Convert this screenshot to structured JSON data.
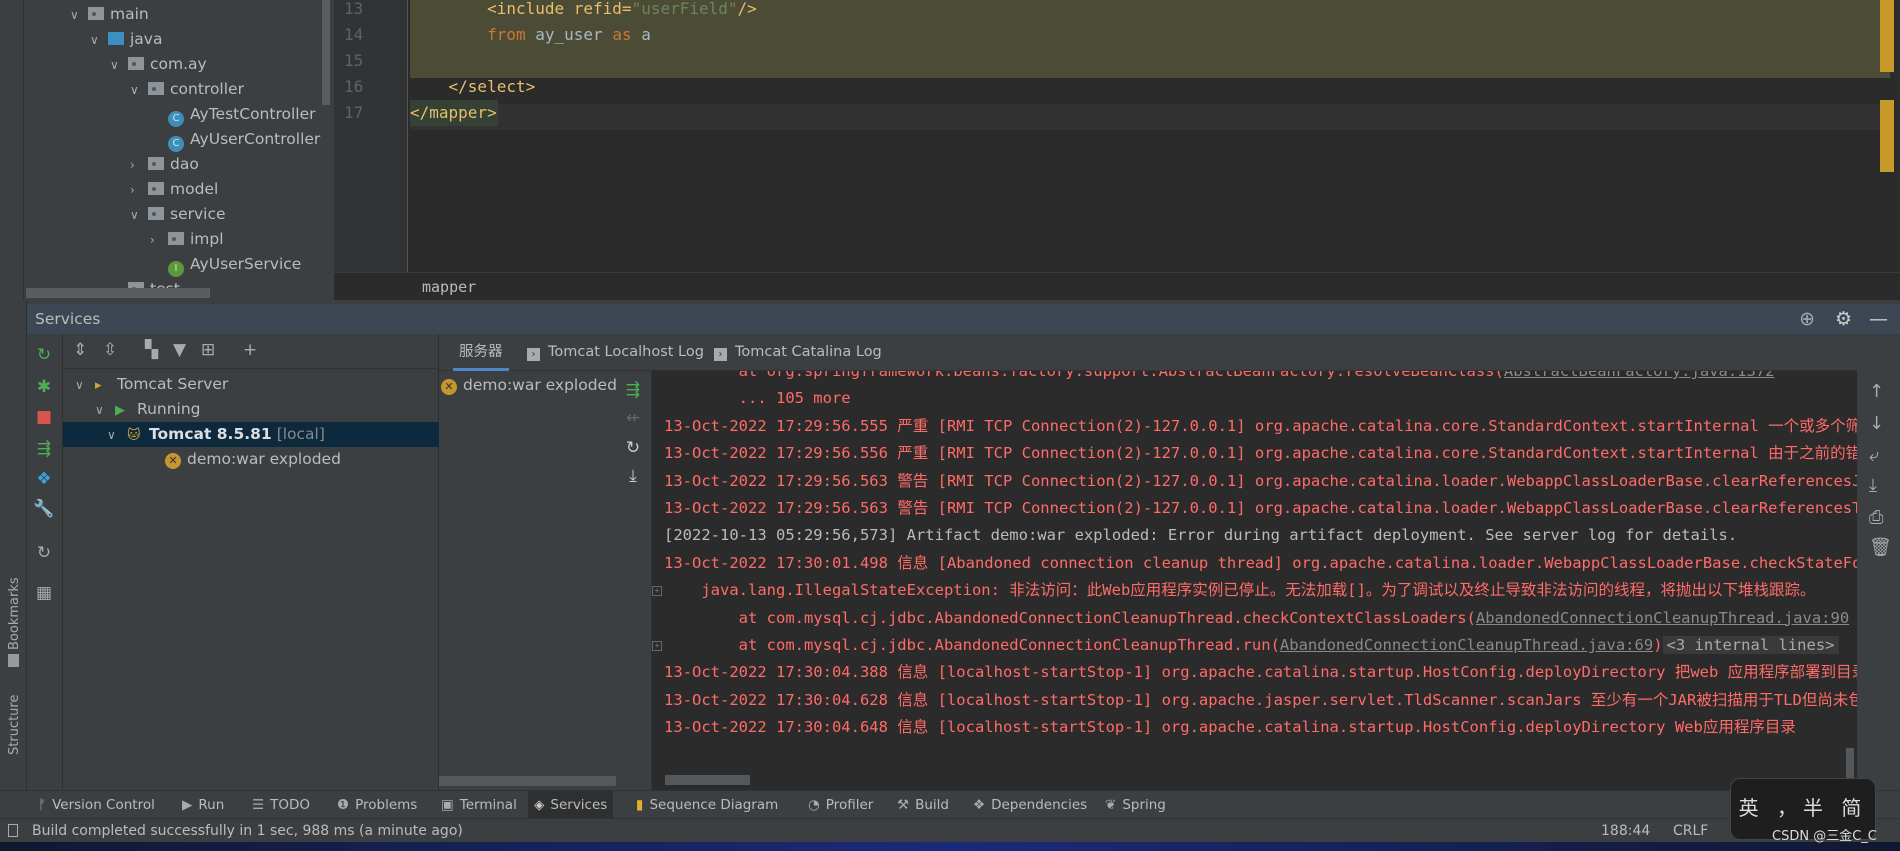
{
  "project_tree": {
    "items": [
      {
        "label": "main",
        "arrow": "expanded",
        "icon": "folder",
        "level": 0
      },
      {
        "label": "java",
        "arrow": "expanded",
        "icon": "source-folder",
        "level": 1
      },
      {
        "label": "com.ay",
        "arrow": "expanded",
        "icon": "package",
        "level": 2
      },
      {
        "label": "controller",
        "arrow": "expanded",
        "icon": "package",
        "level": 3
      },
      {
        "label": "AyTestController",
        "arrow": "",
        "icon": "class",
        "level": 4
      },
      {
        "label": "AyUserController",
        "arrow": "",
        "icon": "class",
        "level": 4
      },
      {
        "label": "dao",
        "arrow": "collapsed",
        "icon": "package",
        "level": 3
      },
      {
        "label": "model",
        "arrow": "collapsed",
        "icon": "package",
        "level": 3
      },
      {
        "label": "service",
        "arrow": "expanded",
        "icon": "package",
        "level": 3
      },
      {
        "label": "impl",
        "arrow": "collapsed",
        "icon": "package",
        "level": 4
      },
      {
        "label": "AyUserService",
        "arrow": "",
        "icon": "interface",
        "level": 4
      },
      {
        "label": "test",
        "arrow": "collapsed",
        "icon": "package",
        "level": 2
      }
    ]
  },
  "editor": {
    "lines": [
      {
        "num": "13",
        "code": "        <include refid=\"userField\"/>"
      },
      {
        "num": "14",
        "code": "        from ay_user as a"
      },
      {
        "num": "15",
        "code": ""
      },
      {
        "num": "16",
        "code": "    </select>"
      },
      {
        "num": "17",
        "code": "</mapper>"
      }
    ],
    "breadcrumb": "mapper"
  },
  "services": {
    "title": "Services",
    "tree": [
      {
        "label": "Tomcat Server",
        "sub": ""
      },
      {
        "label": "Running",
        "sub": ""
      },
      {
        "label": "Tomcat 8.5.81",
        "sub": "[local]"
      },
      {
        "label": "demo:war exploded",
        "sub": ""
      }
    ],
    "tabs": [
      "服务器",
      "Tomcat Localhost Log",
      "Tomcat Catalina Log"
    ],
    "active_tab": "服务器",
    "deployment": "demo:war exploded",
    "console": [
      {
        "t": "        at org.springframework.beans.factory.support.AbstractBeanFactory.resolveBeanClass(",
        "link": "AbstractBeanFactory.java:1372",
        "c": "red"
      },
      {
        "t": "        ... 105 more",
        "c": "red"
      },
      {
        "t": "13-Oct-2022 17:29:56.555 严重 [RMI TCP Connection(2)-127.0.0.1] org.apache.catalina.core.StandardContext.startInternal 一个或多个筛选器启动失败",
        "c": "red"
      },
      {
        "t": "13-Oct-2022 17:29:56.556 严重 [RMI TCP Connection(2)-127.0.0.1] org.apache.catalina.core.StandardContext.startInternal 由于之前的错误",
        "c": "red"
      },
      {
        "t": "13-Oct-2022 17:29:56.563 警告 [RMI TCP Connection(2)-127.0.0.1] org.apache.catalina.loader.WebappClassLoaderBase.clearReferencesJdbc",
        "c": "red"
      },
      {
        "t": "13-Oct-2022 17:29:56.563 警告 [RMI TCP Connection(2)-127.0.0.1] org.apache.catalina.loader.WebappClassLoaderBase.clearReferencesThreads",
        "c": "red"
      },
      {
        "t": "[2022-10-13 05:29:56,573] Artifact demo:war exploded: Error during artifact deployment. See server log for details.",
        "c": "gray"
      },
      {
        "t": "13-Oct-2022 17:30:01.498 信息 [Abandoned connection cleanup thread] org.apache.catalina.loader.WebappClassLoaderBase.checkStateForResourceLoading",
        "c": "red"
      },
      {
        "t": "    java.lang.IllegalStateException: 非法访问：此Web应用程序实例已停止。无法加载[]。为了调试以及终止导致非法访问的线程，将抛出以下堆栈跟踪。",
        "c": "red",
        "fold": true
      },
      {
        "t": "        at com.mysql.cj.jdbc.AbandonedConnectionCleanupThread.checkContextClassLoaders(",
        "link": "AbandonedConnectionCleanupThread.java:90",
        "c": "red"
      },
      {
        "t": "        at com.mysql.cj.jdbc.AbandonedConnectionCleanupThread.run(",
        "link": "AbandonedConnectionCleanupThread.java:69",
        "after": ")",
        "internal": "<3 internal lines>",
        "c": "red",
        "fold": true
      },
      {
        "t": "13-Oct-2022 17:30:04.388 信息 [localhost-startStop-1] org.apache.catalina.startup.HostConfig.deployDirectory 把web 应用程序部署到目录",
        "c": "red"
      },
      {
        "t": "13-Oct-2022 17:30:04.628 信息 [localhost-startStop-1] org.apache.jasper.servlet.TldScanner.scanJars 至少有一个JAR被扫描用于TLD但尚未包含TLD",
        "c": "red"
      },
      {
        "t": "13-Oct-2022 17:30:04.648 信息 [localhost-startStop-1] org.apache.catalina.startup.HostConfig.deployDirectory Web应用程序目录",
        "c": "red"
      }
    ]
  },
  "left_strip": {
    "bookmarks": "Bookmarks",
    "structure": "Structure"
  },
  "bottom_tools": [
    "Version Control",
    "Run",
    "TODO",
    "Problems",
    "Terminal",
    "Services",
    "Sequence Diagram",
    "Profiler",
    "Build",
    "Dependencies",
    "Spring"
  ],
  "bottom_active": "Services",
  "status": {
    "message": "Build completed successfully in 1 sec, 988 ms (a minute ago)",
    "position": "188:44",
    "line_sep": "CRLF"
  },
  "ime": "英 ，半 简",
  "watermark": "CSDN @三金C_C",
  "colors": {
    "error": "#ff6b68",
    "selection": "#0d293e",
    "accent": "#4a88c7",
    "highlight": "#4c4b36"
  }
}
